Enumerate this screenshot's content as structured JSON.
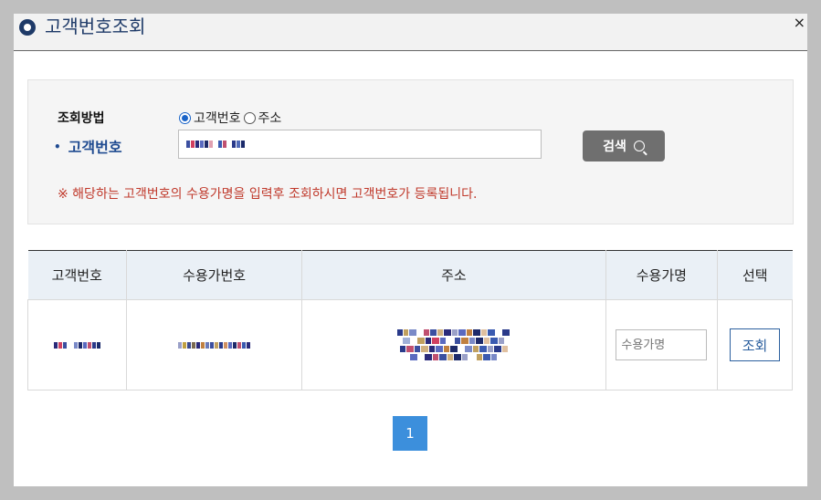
{
  "dialog": {
    "title": "고객번호조회",
    "close_label": "×"
  },
  "search": {
    "method_label": "조회방법",
    "options": [
      {
        "label": "고객번호",
        "checked": true
      },
      {
        "label": "주소",
        "checked": false
      }
    ],
    "field_label": "고객번호",
    "button_label": "검색",
    "notice": "※ 해당하는 고객번호의 수용가명을 입력후 조회하시면 고객번호가 등록됩니다."
  },
  "table": {
    "headers": [
      "고객번호",
      "수용가번호",
      "주소",
      "수용가명",
      "선택"
    ],
    "row": {
      "name_placeholder": "수용가명",
      "select_label": "조회"
    }
  },
  "pagination": {
    "current": "1"
  },
  "colors": {
    "title": "#1e3a68",
    "accent": "#1a64c8",
    "notice": "#c0392b",
    "page_active": "#3c8fdc"
  }
}
